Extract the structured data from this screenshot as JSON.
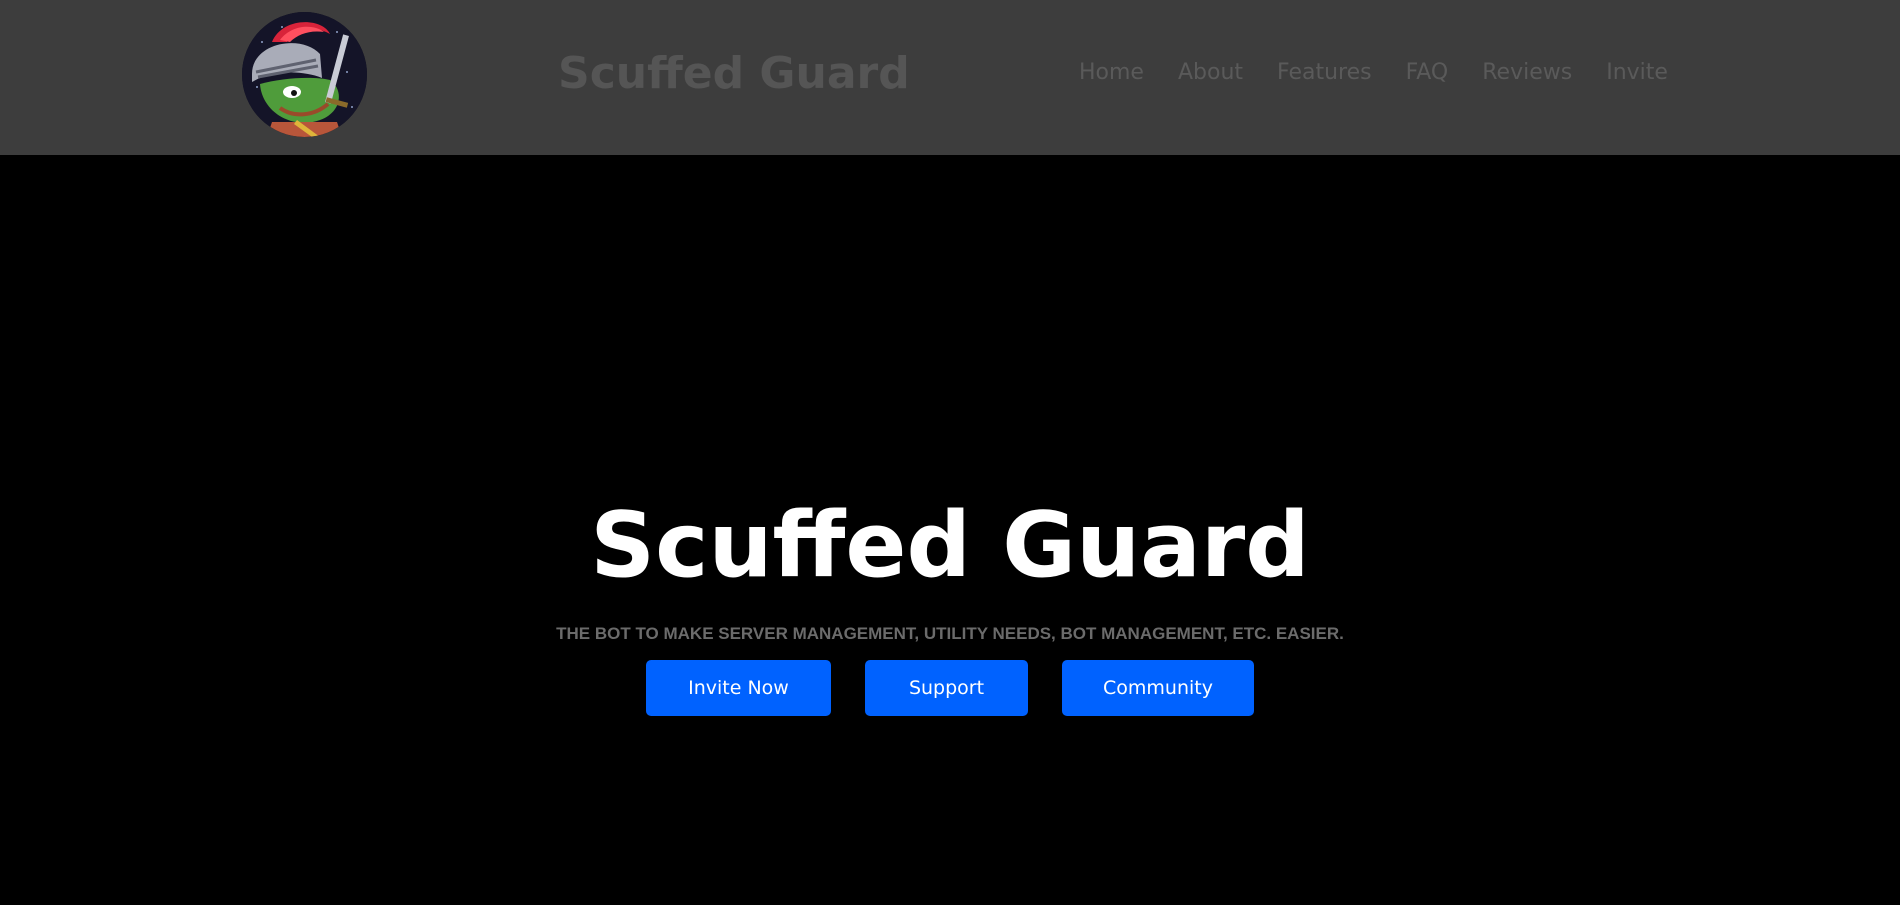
{
  "header": {
    "logo_icon": "knight-frog-avatar-icon",
    "brand": "Scuffed Guard",
    "nav": [
      {
        "label": "Home"
      },
      {
        "label": "About"
      },
      {
        "label": "Features"
      },
      {
        "label": "FAQ"
      },
      {
        "label": "Reviews"
      },
      {
        "label": "Invite"
      }
    ]
  },
  "hero": {
    "title": "Scuffed Guard",
    "subtitle": "THE BOT TO MAKE SERVER MANAGEMENT, UTILITY NEEDS, BOT MANAGEMENT, ETC. EASIER.",
    "buttons": [
      {
        "label": "Invite Now"
      },
      {
        "label": "Support"
      },
      {
        "label": "Community"
      }
    ]
  },
  "colors": {
    "header_bg": "#3d3d3d",
    "page_bg": "#000000",
    "nav_text": "#5a5a5a",
    "brand_text": "#555555",
    "button_bg": "#0062ff",
    "button_text": "#ffffff",
    "subtitle_text": "#6b6b6b"
  }
}
